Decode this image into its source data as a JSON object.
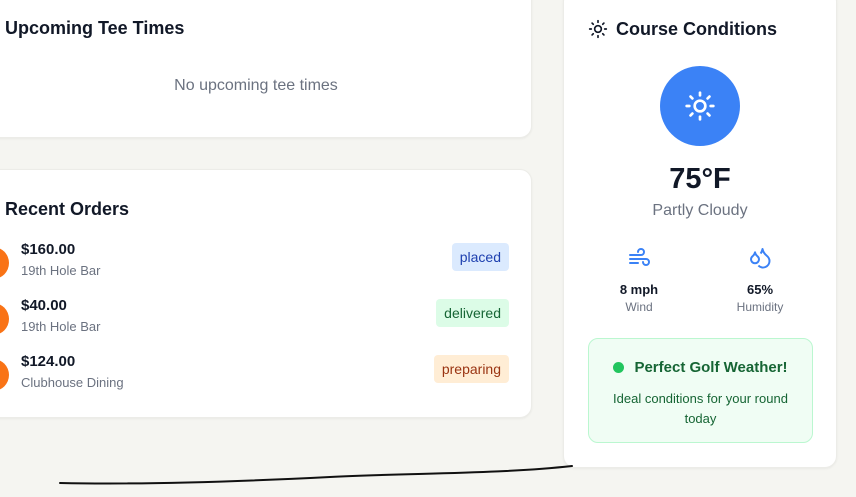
{
  "upcoming": {
    "title": "Upcoming Tee Times",
    "empty_text": "No upcoming tee times"
  },
  "orders": {
    "title": "Recent Orders",
    "items": [
      {
        "amount": "$160.00",
        "location": "19th Hole Bar",
        "status": "placed"
      },
      {
        "amount": "$40.00",
        "location": "19th Hole Bar",
        "status": "delivered"
      },
      {
        "amount": "$124.00",
        "location": "Clubhouse Dining",
        "status": "preparing"
      }
    ]
  },
  "conditions": {
    "title": "Course Conditions",
    "header_icon": "sun-icon",
    "weather_icon": "sun-icon",
    "temperature": "75°F",
    "sky": "Partly Cloudy",
    "wind": {
      "icon": "wind-icon",
      "value": "8 mph",
      "label": "Wind"
    },
    "humidity": {
      "icon": "droplets-icon",
      "value": "65%",
      "label": "Humidity"
    },
    "banner": {
      "title": "Perfect Golf Weather!",
      "subtitle": "Ideal conditions for your round today"
    }
  },
  "colors": {
    "accent_blue": "#3b82f6",
    "order_avatar": "#f97316",
    "good_green": "#22c55e"
  }
}
